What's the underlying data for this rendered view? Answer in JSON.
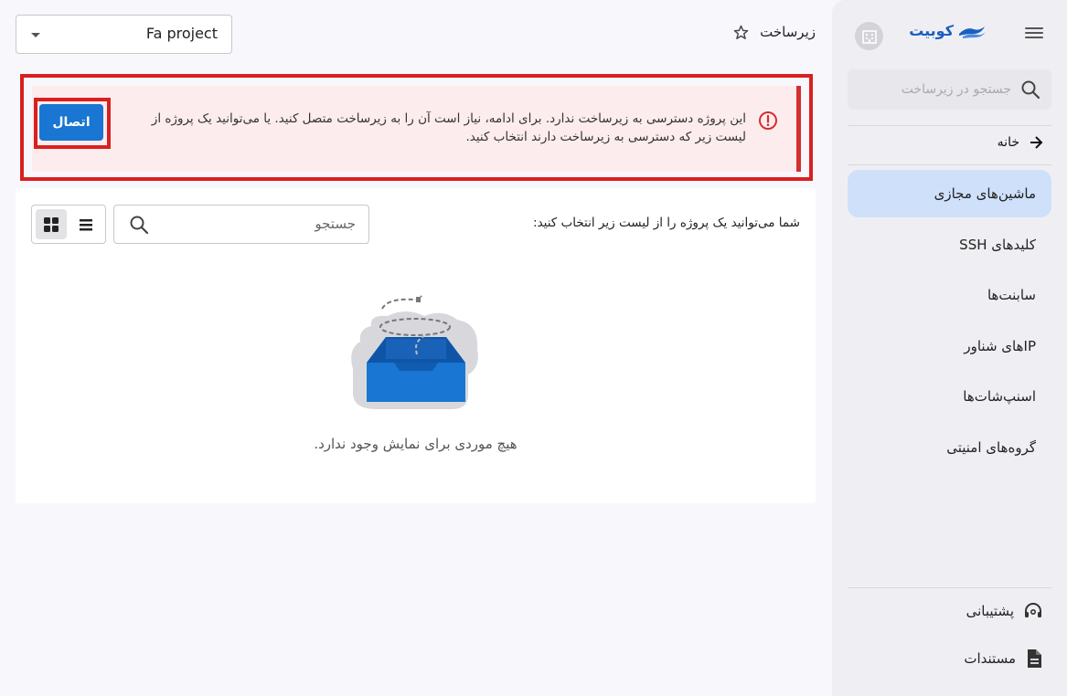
{
  "sidebar": {
    "logo_text": "کوبیت",
    "search_placeholder": "جستجو در زیرساخت",
    "home_label": "خانه",
    "items": [
      {
        "label": "ماشین‌های مجازی",
        "active": true
      },
      {
        "label": "کلیدهای SSH",
        "active": false
      },
      {
        "label": "سابنت‌ها",
        "active": false
      },
      {
        "label": "IPهای شناور",
        "active": false
      },
      {
        "label": "اسنپ‌شات‌ها",
        "active": false
      },
      {
        "label": "گروه‌های امنیتی",
        "active": false
      }
    ],
    "support_label": "پشتیبانی",
    "docs_label": "مستندات"
  },
  "header": {
    "breadcrumb": "زیرساخت",
    "project_select_value": "Fa project"
  },
  "alert": {
    "message": "این پروژه دسترسی به زیرساخت ندارد. برای ادامه، نیاز است آن را به زیرساخت متصل کنید. یا می‌توانید یک پروژه از لیست زیر که دسترسی به زیرساخت دارند انتخاب کنید.",
    "connect_label": "اتصال"
  },
  "main": {
    "list_label": "شما می‌توانید یک پروژه را از لیست زیر انتخاب کنید:",
    "search_placeholder": "جستجو",
    "empty_text": "هیچ موردی برای نمایش وجود ندارد."
  },
  "colors": {
    "accent": "#1976d2",
    "active_nav": "#cfe0fb",
    "alert_bg": "#fdeced",
    "alert_border": "#d32f2f"
  }
}
